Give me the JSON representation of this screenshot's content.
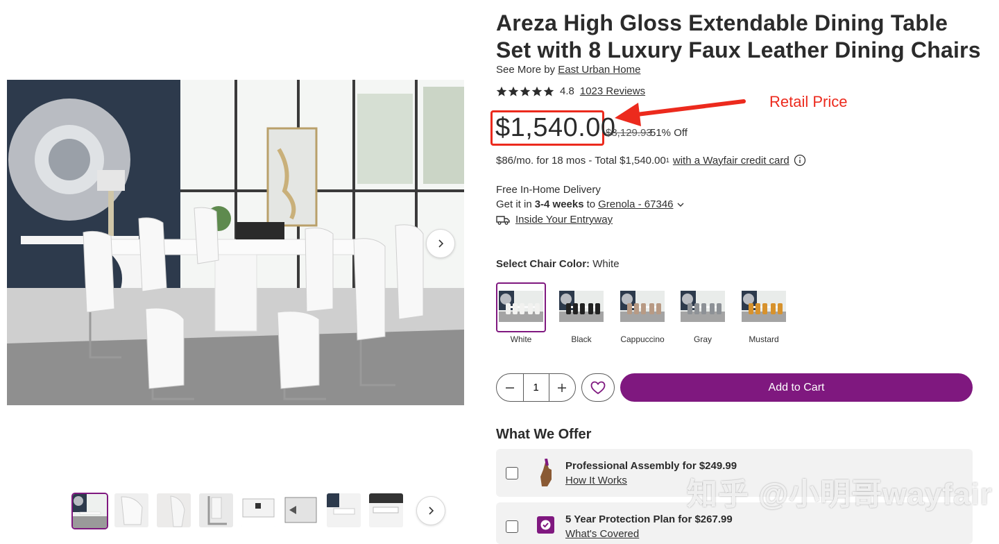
{
  "product": {
    "title": "Areza High Gloss Extendable Dining Table Set with 8 Luxury Faux Leather Dining Chairs",
    "see_more_prefix": "See More by",
    "brand": "East Urban Home",
    "rating": "4.8",
    "rating_stars": 5,
    "reviews_link": "1023 Reviews"
  },
  "annotation": {
    "label": "Retail Price",
    "color": "#ec2a1d"
  },
  "pricing": {
    "price": "$1,540.00",
    "original_price": "$3,129.93",
    "discount": "51% Off",
    "financing_text": "$86/mo. for 18 mos - Total $1,540.00",
    "financing_sup": "1",
    "financing_link": "with a Wayfair credit card"
  },
  "delivery": {
    "title": "Free In-Home Delivery",
    "get_it_in": "Get it in",
    "eta": "3-4 weeks",
    "to": "to",
    "location": "Grenola - 67346",
    "service_link": "Inside Your Entryway"
  },
  "options": {
    "label": "Select Chair Color:",
    "selected": "White",
    "swatches": [
      {
        "label": "White",
        "chair_color": "#f2f2f0"
      },
      {
        "label": "Black",
        "chair_color": "#222222"
      },
      {
        "label": "Cappuccino",
        "chair_color": "#b89a84"
      },
      {
        "label": "Gray",
        "chair_color": "#8d9196"
      },
      {
        "label": "Mustard",
        "chair_color": "#d7922d"
      }
    ]
  },
  "cart": {
    "quantity": "1",
    "add_to_cart": "Add to Cart"
  },
  "offers": {
    "heading": "What We Offer",
    "items": [
      {
        "title": "Professional Assembly for $249.99",
        "link": "How It Works"
      },
      {
        "title": "5 Year Protection Plan for $267.99",
        "link": "What's Covered"
      }
    ]
  },
  "watermark": "知乎 @小明哥wayfair",
  "colors": {
    "brand_purple": "#7f187f",
    "annotation_red": "#ec2a1d"
  }
}
